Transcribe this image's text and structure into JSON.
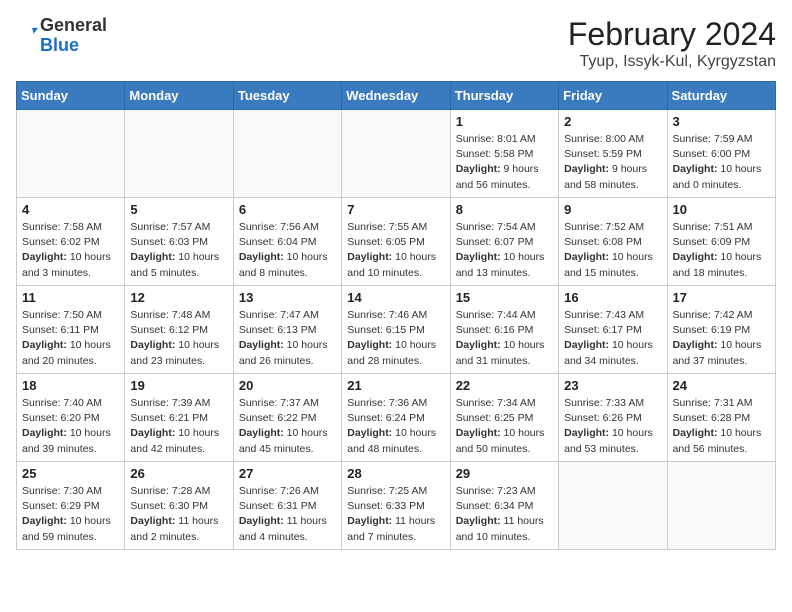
{
  "header": {
    "logo_general": "General",
    "logo_blue": "Blue",
    "month_year": "February 2024",
    "location": "Tyup, Issyk-Kul, Kyrgyzstan"
  },
  "days_of_week": [
    "Sunday",
    "Monday",
    "Tuesday",
    "Wednesday",
    "Thursday",
    "Friday",
    "Saturday"
  ],
  "weeks": [
    [
      {
        "day": "",
        "empty": true
      },
      {
        "day": "",
        "empty": true
      },
      {
        "day": "",
        "empty": true
      },
      {
        "day": "",
        "empty": true
      },
      {
        "day": "1",
        "sunrise": "8:01 AM",
        "sunset": "5:58 PM",
        "daylight": "9 hours and 56 minutes."
      },
      {
        "day": "2",
        "sunrise": "8:00 AM",
        "sunset": "5:59 PM",
        "daylight": "9 hours and 58 minutes."
      },
      {
        "day": "3",
        "sunrise": "7:59 AM",
        "sunset": "6:00 PM",
        "daylight": "10 hours and 0 minutes."
      }
    ],
    [
      {
        "day": "4",
        "sunrise": "7:58 AM",
        "sunset": "6:02 PM",
        "daylight": "10 hours and 3 minutes."
      },
      {
        "day": "5",
        "sunrise": "7:57 AM",
        "sunset": "6:03 PM",
        "daylight": "10 hours and 5 minutes."
      },
      {
        "day": "6",
        "sunrise": "7:56 AM",
        "sunset": "6:04 PM",
        "daylight": "10 hours and 8 minutes."
      },
      {
        "day": "7",
        "sunrise": "7:55 AM",
        "sunset": "6:05 PM",
        "daylight": "10 hours and 10 minutes."
      },
      {
        "day": "8",
        "sunrise": "7:54 AM",
        "sunset": "6:07 PM",
        "daylight": "10 hours and 13 minutes."
      },
      {
        "day": "9",
        "sunrise": "7:52 AM",
        "sunset": "6:08 PM",
        "daylight": "10 hours and 15 minutes."
      },
      {
        "day": "10",
        "sunrise": "7:51 AM",
        "sunset": "6:09 PM",
        "daylight": "10 hours and 18 minutes."
      }
    ],
    [
      {
        "day": "11",
        "sunrise": "7:50 AM",
        "sunset": "6:11 PM",
        "daylight": "10 hours and 20 minutes."
      },
      {
        "day": "12",
        "sunrise": "7:48 AM",
        "sunset": "6:12 PM",
        "daylight": "10 hours and 23 minutes."
      },
      {
        "day": "13",
        "sunrise": "7:47 AM",
        "sunset": "6:13 PM",
        "daylight": "10 hours and 26 minutes."
      },
      {
        "day": "14",
        "sunrise": "7:46 AM",
        "sunset": "6:15 PM",
        "daylight": "10 hours and 28 minutes."
      },
      {
        "day": "15",
        "sunrise": "7:44 AM",
        "sunset": "6:16 PM",
        "daylight": "10 hours and 31 minutes."
      },
      {
        "day": "16",
        "sunrise": "7:43 AM",
        "sunset": "6:17 PM",
        "daylight": "10 hours and 34 minutes."
      },
      {
        "day": "17",
        "sunrise": "7:42 AM",
        "sunset": "6:19 PM",
        "daylight": "10 hours and 37 minutes."
      }
    ],
    [
      {
        "day": "18",
        "sunrise": "7:40 AM",
        "sunset": "6:20 PM",
        "daylight": "10 hours and 39 minutes."
      },
      {
        "day": "19",
        "sunrise": "7:39 AM",
        "sunset": "6:21 PM",
        "daylight": "10 hours and 42 minutes."
      },
      {
        "day": "20",
        "sunrise": "7:37 AM",
        "sunset": "6:22 PM",
        "daylight": "10 hours and 45 minutes."
      },
      {
        "day": "21",
        "sunrise": "7:36 AM",
        "sunset": "6:24 PM",
        "daylight": "10 hours and 48 minutes."
      },
      {
        "day": "22",
        "sunrise": "7:34 AM",
        "sunset": "6:25 PM",
        "daylight": "10 hours and 50 minutes."
      },
      {
        "day": "23",
        "sunrise": "7:33 AM",
        "sunset": "6:26 PM",
        "daylight": "10 hours and 53 minutes."
      },
      {
        "day": "24",
        "sunrise": "7:31 AM",
        "sunset": "6:28 PM",
        "daylight": "10 hours and 56 minutes."
      }
    ],
    [
      {
        "day": "25",
        "sunrise": "7:30 AM",
        "sunset": "6:29 PM",
        "daylight": "10 hours and 59 minutes."
      },
      {
        "day": "26",
        "sunrise": "7:28 AM",
        "sunset": "6:30 PM",
        "daylight": "11 hours and 2 minutes."
      },
      {
        "day": "27",
        "sunrise": "7:26 AM",
        "sunset": "6:31 PM",
        "daylight": "11 hours and 4 minutes."
      },
      {
        "day": "28",
        "sunrise": "7:25 AM",
        "sunset": "6:33 PM",
        "daylight": "11 hours and 7 minutes."
      },
      {
        "day": "29",
        "sunrise": "7:23 AM",
        "sunset": "6:34 PM",
        "daylight": "11 hours and 10 minutes."
      },
      {
        "day": "",
        "empty": true
      },
      {
        "day": "",
        "empty": true
      }
    ]
  ],
  "labels": {
    "sunrise": "Sunrise:",
    "sunset": "Sunset:",
    "daylight": "Daylight:"
  }
}
